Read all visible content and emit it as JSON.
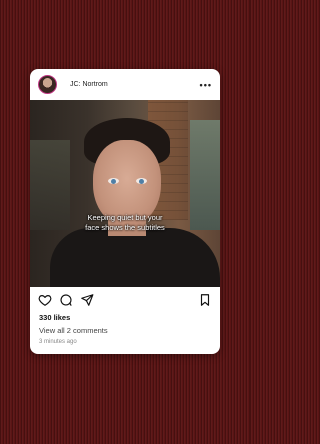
{
  "post": {
    "username": "JC: Nortrom",
    "more_label": "•••",
    "subtitle": "Keeping quiet but your\nface shows the subtitles",
    "likes": "330 likes",
    "comments_link": "View all 2 comments",
    "timestamp": "3 minutes ago"
  },
  "icons": {
    "like": "heart-icon",
    "comment": "comment-icon",
    "share": "send-icon",
    "save": "bookmark-icon",
    "more": "more-icon"
  },
  "colors": {
    "background": "#5a1414",
    "card": "#ffffff",
    "avatar_ring": "#c13584"
  }
}
